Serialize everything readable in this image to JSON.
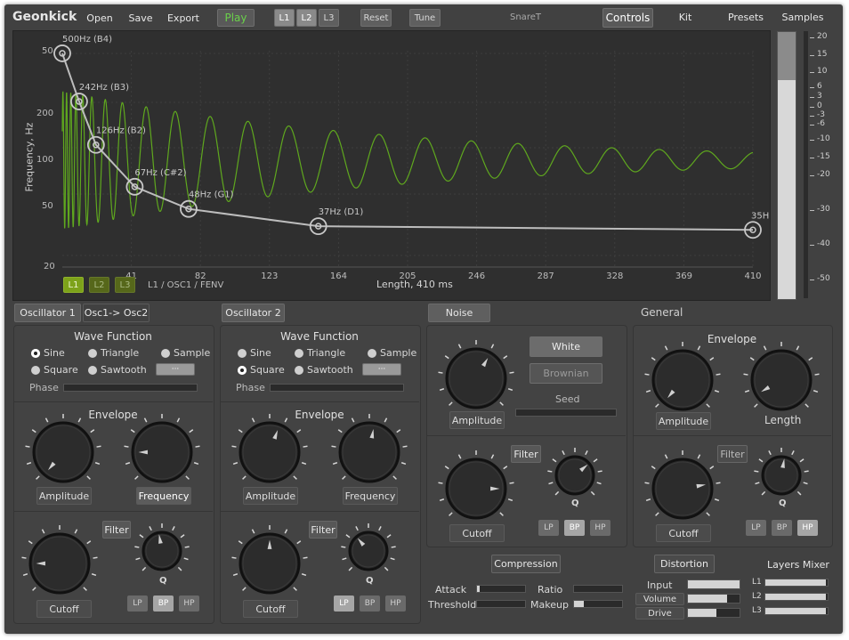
{
  "app_title": "Geonkick",
  "toolbar": {
    "open": "Open",
    "save": "Save",
    "export": "Export",
    "play": "Play",
    "layers": [
      "L1",
      "L2",
      "L3"
    ],
    "reset": "Reset",
    "tune": "Tune",
    "preset_name": "SnareT"
  },
  "nav_tabs": [
    "Controls",
    "Kit",
    "Presets",
    "Samples"
  ],
  "envelope_view": {
    "y_axis_label": "Frequency, Hz",
    "y_ticks": [
      "50",
      "200",
      "100",
      "50",
      "20"
    ],
    "x_ticks": [
      "41",
      "82",
      "123",
      "164",
      "205",
      "246",
      "287",
      "328",
      "369",
      "410"
    ],
    "points": [
      {
        "label": "500Hz (B4)",
        "t_ms": 0,
        "hz": 500
      },
      {
        "label": "242Hz (B3)",
        "t_ms": 10,
        "hz": 242
      },
      {
        "label": "126Hz (B2)",
        "t_ms": 20,
        "hz": 126
      },
      {
        "label": "67Hz (C#2)",
        "t_ms": 43,
        "hz": 67
      },
      {
        "label": "48Hz (G1)",
        "t_ms": 75,
        "hz": 48
      },
      {
        "label": "37Hz (D1)",
        "t_ms": 152,
        "hz": 37
      },
      {
        "label": "35H",
        "t_ms": 410,
        "hz": 35
      }
    ],
    "layer_buttons": [
      "L1",
      "L2",
      "L3"
    ],
    "path_label": "L1 / OSC1 / FENV",
    "length_label": "Length, 410 ms"
  },
  "meter": {
    "scale": [
      "20",
      "15",
      "10",
      "6",
      "3",
      "0",
      "-3",
      "-6",
      "-10",
      "-15",
      "-20",
      "-30",
      "-40",
      "-50"
    ],
    "level_db": 0
  },
  "osc1": {
    "tabs": [
      "Oscillator 1",
      "Osc1-> Osc2"
    ],
    "wave_title": "Wave Function",
    "waves": [
      "Sine",
      "Triangle",
      "Sample",
      "Square",
      "Sawtooth"
    ],
    "selected_wave": "Sine",
    "dots": "···",
    "phase_label": "Phase",
    "envelope_title": "Envelope",
    "amplitude": "Amplitude",
    "frequency": "Frequency",
    "filter": "Filter",
    "cutoff": "Cutoff",
    "q": "Q",
    "filter_types": [
      "LP",
      "BP",
      "HP"
    ],
    "filter_type": "BP"
  },
  "osc2": {
    "tab": "Oscillator 2",
    "wave_title": "Wave Function",
    "waves": [
      "Sine",
      "Triangle",
      "Sample",
      "Square",
      "Sawtooth"
    ],
    "selected_wave": "Square",
    "dots": "···",
    "phase_label": "Phase",
    "envelope_title": "Envelope",
    "amplitude": "Amplitude",
    "frequency": "Frequency",
    "filter": "Filter",
    "cutoff": "Cutoff",
    "q": "Q",
    "filter_types": [
      "LP",
      "BP",
      "HP"
    ],
    "filter_type": "LP"
  },
  "noise": {
    "tab": "Noise",
    "white": "White",
    "brownian": "Brownian",
    "seed": "Seed",
    "amplitude": "Amplitude",
    "filter": "Filter",
    "cutoff": "Cutoff",
    "q": "Q",
    "filter_types": [
      "LP",
      "BP",
      "HP"
    ],
    "filter_type": "BP"
  },
  "general": {
    "title": "General",
    "envelope_title": "Envelope",
    "amplitude": "Amplitude",
    "length": "Length",
    "filter": "Filter",
    "cutoff": "Cutoff",
    "q": "Q",
    "filter_types": [
      "LP",
      "BP",
      "HP"
    ],
    "filter_type": "HP"
  },
  "compression": {
    "title": "Compression",
    "attack": "Attack",
    "ratio": "Ratio",
    "threshold": "Threshold",
    "makeup": "Makeup",
    "attack_value": 0.05,
    "ratio_value": 0,
    "threshold_value": 0,
    "makeup_value": 0.2
  },
  "distortion": {
    "title": "Distortion",
    "input": "Input",
    "volume": "Volume",
    "drive": "Drive",
    "input_value": 1.0,
    "volume_value": 0.75,
    "drive_value": 0.55
  },
  "layers_mixer": {
    "title": "Layers Mixer",
    "layers": [
      "L1",
      "L2",
      "L3"
    ],
    "values": [
      0.97,
      0.97,
      0.97
    ]
  },
  "colors": {
    "wave": "#5fa81e",
    "accent_green": "#6ac94a",
    "layer_on": "#7da21a",
    "layer_off": "#56671a"
  }
}
